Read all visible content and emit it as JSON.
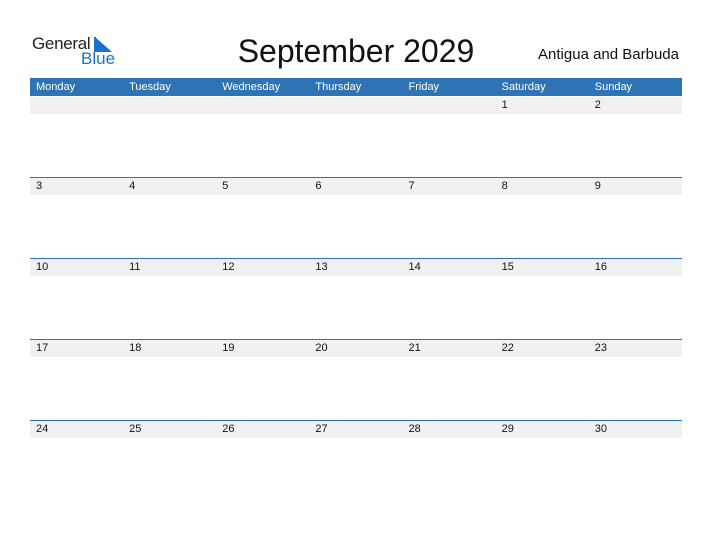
{
  "logo": {
    "general": "General",
    "blue": "Blue"
  },
  "title": "September 2029",
  "country": "Antigua and Barbuda",
  "weekdays": [
    "Monday",
    "Tuesday",
    "Wednesday",
    "Thursday",
    "Friday",
    "Saturday",
    "Sunday"
  ],
  "weeks": [
    [
      "",
      "",
      "",
      "",
      "",
      "1",
      "2"
    ],
    [
      "3",
      "4",
      "5",
      "6",
      "7",
      "8",
      "9"
    ],
    [
      "10",
      "11",
      "12",
      "13",
      "14",
      "15",
      "16"
    ],
    [
      "17",
      "18",
      "19",
      "20",
      "21",
      "22",
      "23"
    ],
    [
      "24",
      "25",
      "26",
      "27",
      "28",
      "29",
      "30"
    ]
  ],
  "colors": {
    "accent": "#2e74b5",
    "row_band": "#f1f1f1"
  }
}
